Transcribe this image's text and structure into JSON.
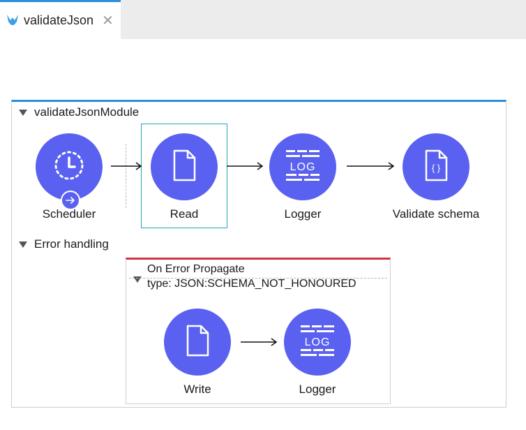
{
  "tab": {
    "title": "validateJson",
    "close_glyph": "✕"
  },
  "flow": {
    "title": "validateJsonModule",
    "nodes": [
      {
        "label": "Scheduler",
        "icon": "clock-icon"
      },
      {
        "label": "Read",
        "icon": "file-icon"
      },
      {
        "label": "Logger",
        "icon": "log-icon"
      },
      {
        "label": "Validate schema",
        "icon": "json-schema-icon"
      }
    ],
    "error_handling": {
      "title": "Error handling",
      "handler": {
        "title": "On Error Propagate",
        "type": "type: JSON:SCHEMA_NOT_HONOURED",
        "nodes": [
          {
            "label": "Write",
            "icon": "file-icon"
          },
          {
            "label": "Logger",
            "icon": "log-icon"
          }
        ]
      }
    }
  },
  "colors": {
    "node": "#5a61f0",
    "accent": "#2c8fde",
    "error": "#d0343f",
    "selection": "#1fa5b5"
  }
}
